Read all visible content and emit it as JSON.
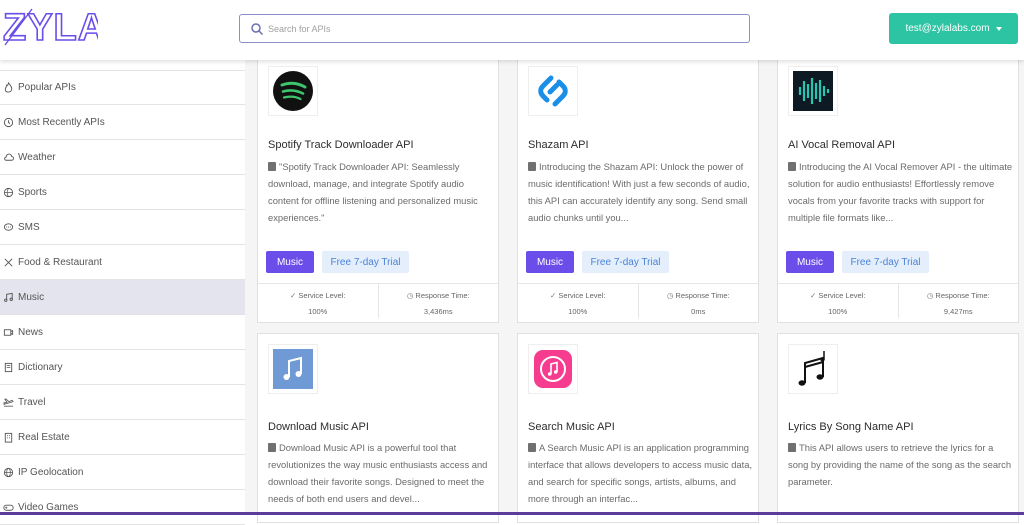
{
  "brand": {
    "logo_text": "ZYLA",
    "logo_color": "#6b4eea"
  },
  "search": {
    "placeholder": "Search for APIs"
  },
  "user": {
    "email": "test@zylalabs.com"
  },
  "sidebar": {
    "items": [
      {
        "label": "Popular APIs",
        "icon": "fire-icon"
      },
      {
        "label": "Most Recently APIs",
        "icon": "history-icon"
      },
      {
        "label": "Weather",
        "icon": "cloud-icon"
      },
      {
        "label": "Sports",
        "icon": "ball-icon"
      },
      {
        "label": "SMS",
        "icon": "message-icon"
      },
      {
        "label": "Food & Restaurant",
        "icon": "utensils-icon"
      },
      {
        "label": "Music",
        "icon": "music-note-icon"
      },
      {
        "label": "News",
        "icon": "newspaper-icon"
      },
      {
        "label": "Dictionary",
        "icon": "book-icon"
      },
      {
        "label": "Travel",
        "icon": "plane-icon"
      },
      {
        "label": "Real Estate",
        "icon": "building-icon"
      },
      {
        "label": "IP Geolocation",
        "icon": "globe-icon"
      },
      {
        "label": "Video Games",
        "icon": "gamepad-icon"
      }
    ],
    "active_index": 6
  },
  "cards": [
    {
      "title": "Spotify Track Downloader API",
      "description": "\"Spotify Track Downloader API: Seamlessly download, manage, and integrate Spotify audio content for offline listening and personalized music experiences.\"",
      "tag": "Music",
      "trial": "Free 7-day Trial",
      "service_label": "Service Level:",
      "service_value": "100%",
      "response_label": "Response Time:",
      "response_value": "3,436ms",
      "icon": "spotify-logo"
    },
    {
      "title": "Shazam API",
      "description": "Introducing the Shazam API: Unlock the power of music identification! With just a few seconds of audio, this API can accurately identify any song. Send small audio chunks until you...",
      "tag": "Music",
      "trial": "Free 7-day Trial",
      "service_label": "Service Level:",
      "service_value": "100%",
      "response_label": "Response Time:",
      "response_value": "0ms",
      "icon": "shazam-logo"
    },
    {
      "title": "AI Vocal Removal API",
      "description": "Introducing the AI Vocal Remover API - the ultimate solution for audio enthusiasts! Effortlessly remove vocals from your favorite tracks with support for multiple file formats like...",
      "tag": "Music",
      "trial": "Free 7-day Trial",
      "service_label": "Service Level:",
      "service_value": "100%",
      "response_label": "Response Time:",
      "response_value": "9,427ms",
      "icon": "waveform-logo"
    },
    {
      "title": "Download Music API",
      "description": "Download Music API is a powerful tool that revolutionizes the way music enthusiasts access and download their favorite songs. Designed to meet the needs of both end users and devel...",
      "icon": "music-file-logo"
    },
    {
      "title": "Search Music API",
      "description": "A Search Music API is an application programming interface that allows developers to access music data, and search for specific songs, artists, albums, and more through an interfac...",
      "icon": "itunes-logo"
    },
    {
      "title": "Lyrics By Song Name API",
      "description": "This API allows users to retrieve the lyrics for a song by providing the name of the song as the search parameter.",
      "icon": "music-notes-logo"
    }
  ]
}
